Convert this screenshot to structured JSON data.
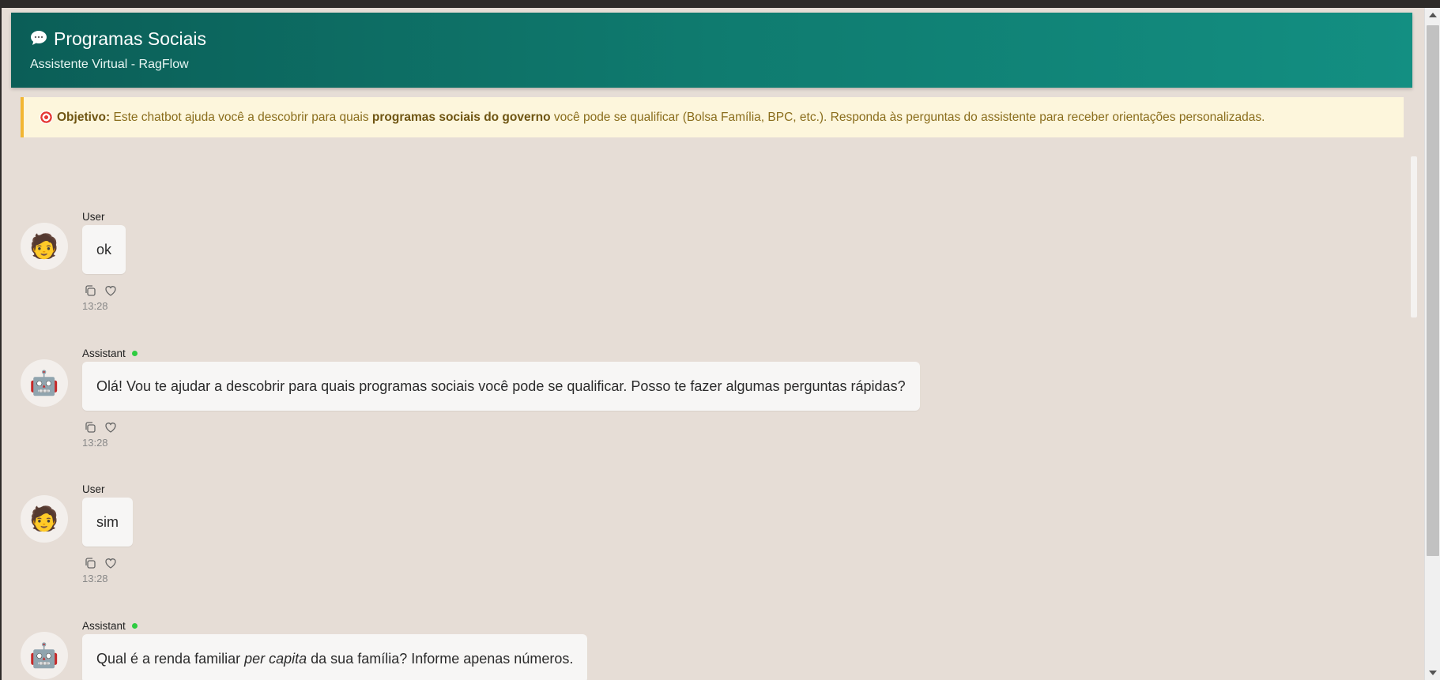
{
  "header": {
    "icon": "chat-bubble-icon",
    "title": "Programas Sociais",
    "subtitle": "Assistente Virtual - RagFlow"
  },
  "objective": {
    "icon": "target-icon",
    "label": "Objetivo:",
    "text_before": " Este chatbot ajuda você a descobrir para quais ",
    "bold_text": "programas sociais do governo",
    "text_after": " você pode se qualificar (Bolsa Família, BPC, etc.). Responda às perguntas do assistente para receber orientações personalizadas."
  },
  "messages": [
    {
      "role": "user",
      "sender": "User",
      "avatar": "🧑",
      "text": "ok",
      "time": "13:28"
    },
    {
      "role": "assistant",
      "sender": "Assistant",
      "avatar": "🤖",
      "text": "Olá! Vou te ajudar a descobrir para quais programas sociais você pode se qualificar. Posso te fazer algumas perguntas rápidas?",
      "time": "13:28"
    },
    {
      "role": "user",
      "sender": "User",
      "avatar": "🧑",
      "text": "sim",
      "time": "13:28"
    },
    {
      "role": "assistant",
      "sender": "Assistant",
      "avatar": "🤖",
      "text_before": "Qual é a renda familiar ",
      "text_italic": "per capita",
      "text_after": " da sua família? Informe apenas números."
    }
  ],
  "colors": {
    "header_start": "#0b5e57",
    "header_end": "#138f82",
    "objective_bg": "#fdf6dc",
    "objective_border": "#f2b632",
    "chat_bg": "#e6ddd6",
    "online": "#2ecc40"
  }
}
